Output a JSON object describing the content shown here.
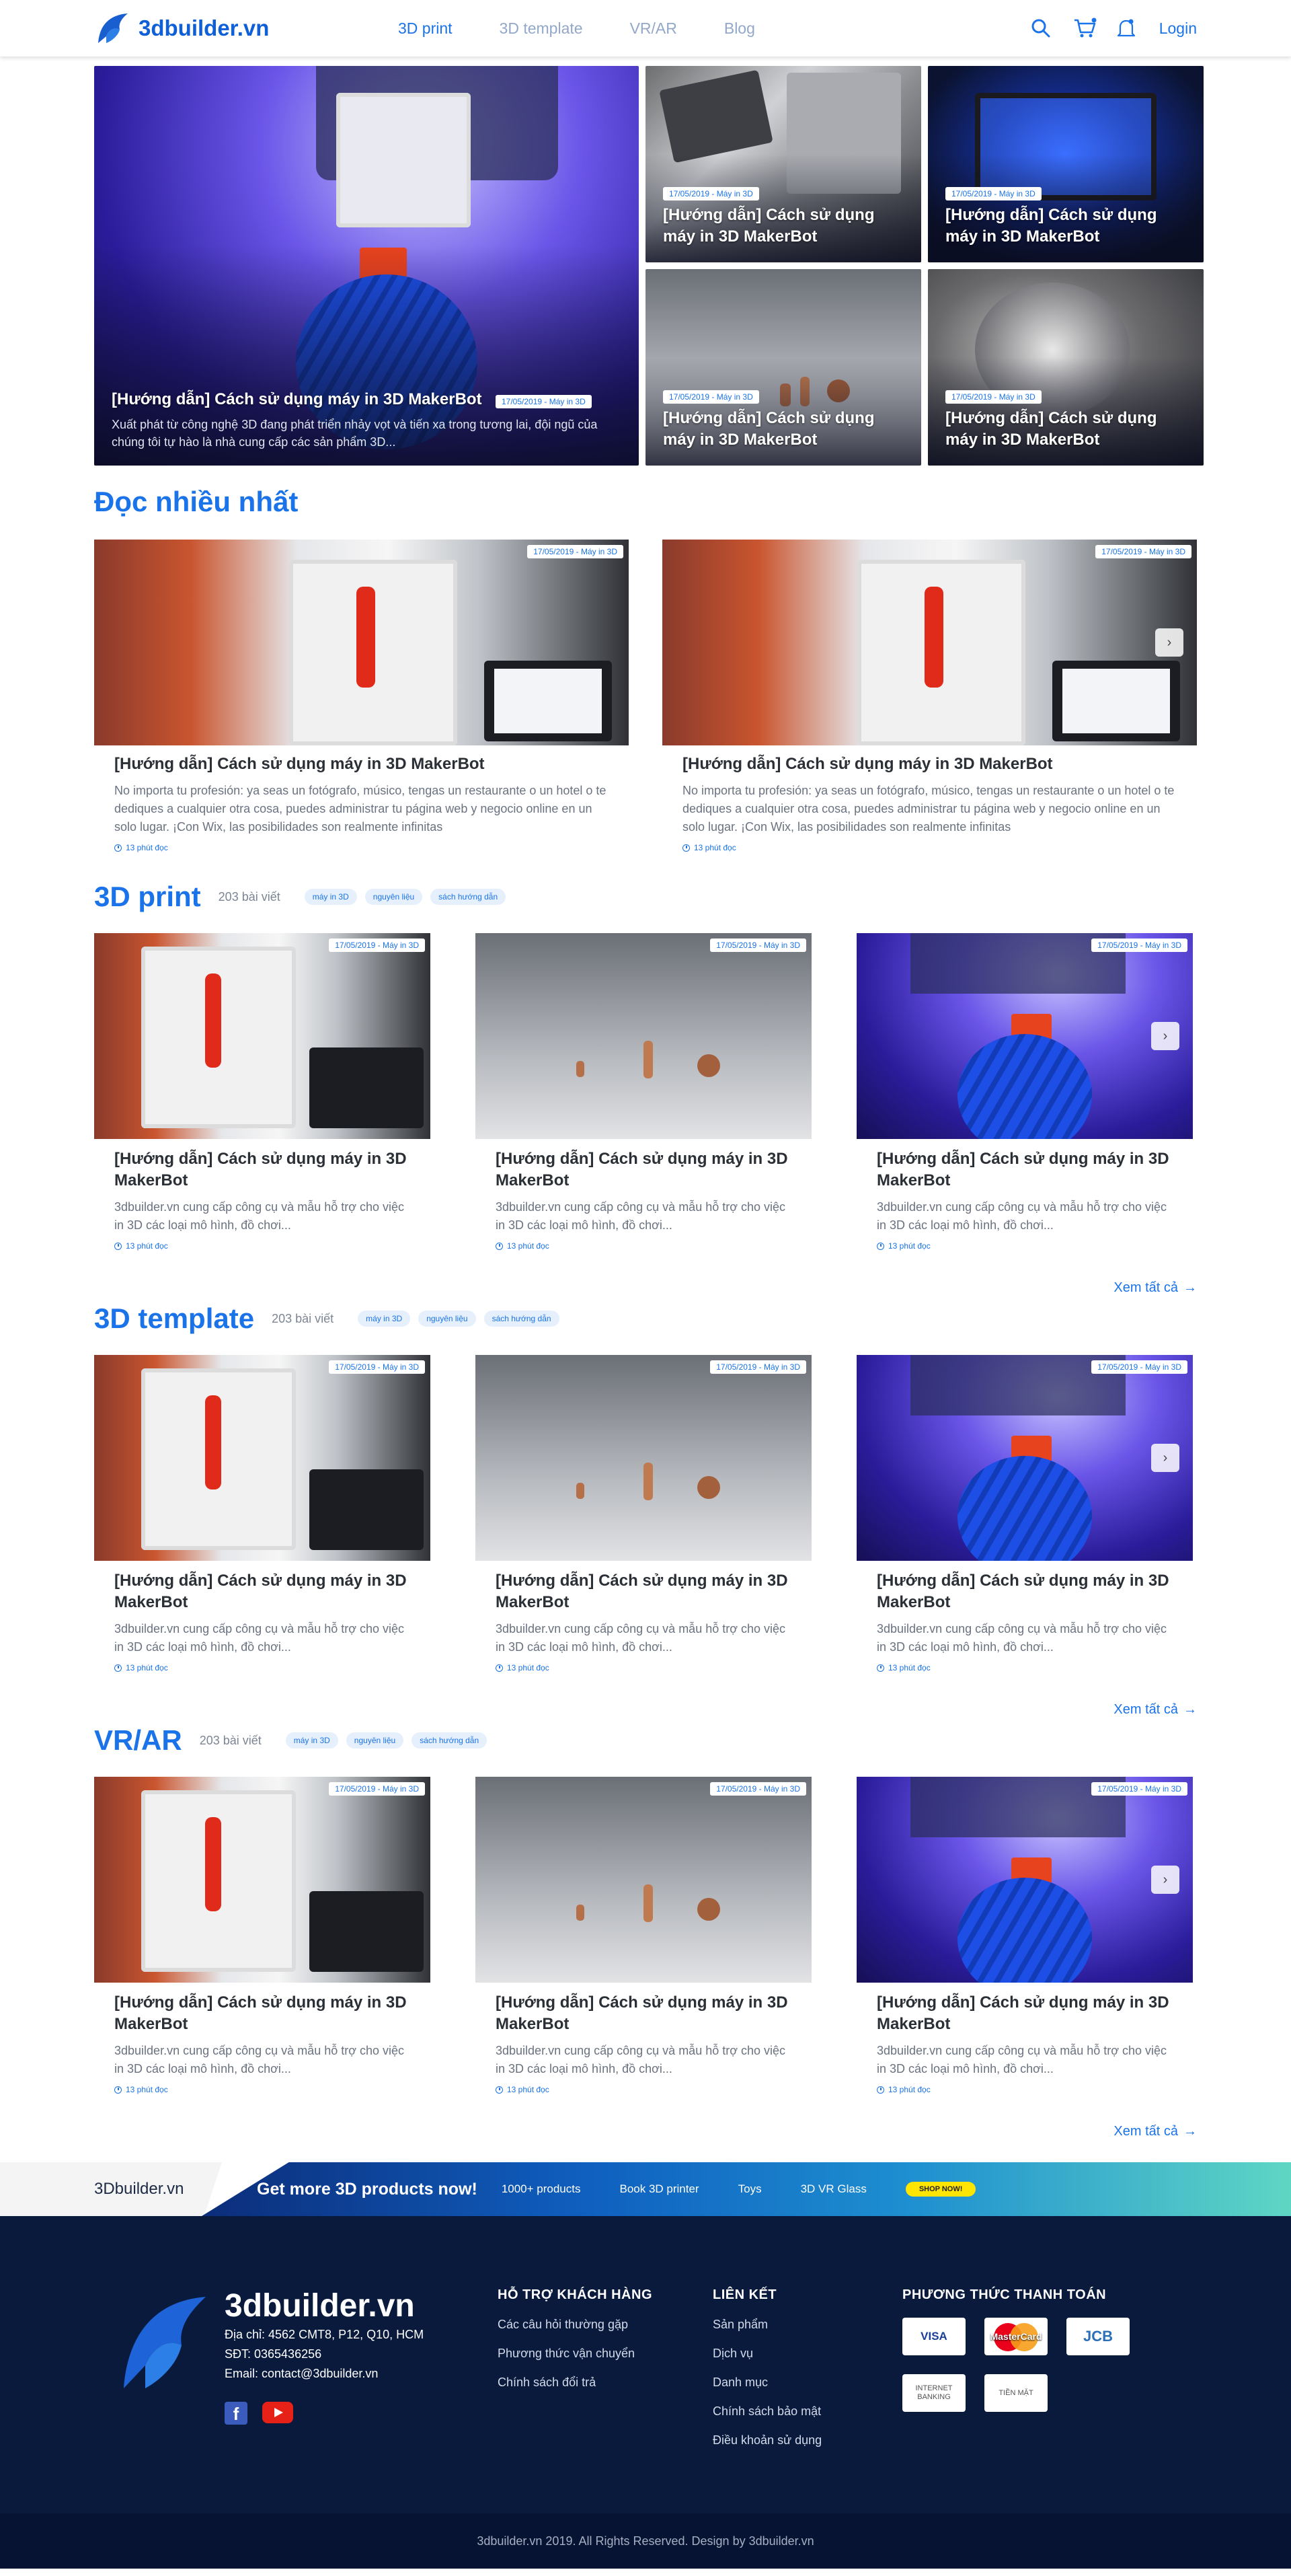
{
  "header": {
    "brand": "3dbuilder.vn",
    "nav": [
      "3D print",
      "3D template",
      "VR/AR",
      "Blog"
    ],
    "nav_active": "3D print",
    "login": "Login",
    "icons": [
      "search-icon",
      "cart-icon",
      "bell-icon"
    ]
  },
  "hero": {
    "main": {
      "title": "[Hướng dẫn] Cách sử dụng máy in 3D MakerBot",
      "badge": "17/05/2019 - Máy in 3D",
      "excerpt": "Xuất phát từ công nghệ 3D đang phát triển nhảy vọt và tiến xa trong tương lai, đội ngũ của chúng tôi tự hào là nhà cung cấp các sản phẩm 3D..."
    },
    "items": [
      {
        "title": "[Hướng dẫn] Cách sử dụng máy in 3D MakerBot",
        "badge": "17/05/2019 - Máy in 3D"
      },
      {
        "title": "[Hướng dẫn] Cách sử dụng máy in 3D MakerBot",
        "badge": "17/05/2019 - Máy in 3D"
      },
      {
        "title": "[Hướng dẫn] Cách sử dụng máy in 3D MakerBot",
        "badge": "17/05/2019 - Máy in 3D"
      },
      {
        "title": "[Hướng dẫn] Cách sử dụng máy in 3D MakerBot",
        "badge": "17/05/2019 - Máy in 3D"
      }
    ]
  },
  "popular": {
    "title": "Đọc nhiều nhất",
    "items": [
      {
        "badge": "17/05/2019 - Máy in 3D",
        "title": "[Hướng dẫn] Cách sử dụng máy in 3D MakerBot",
        "text": "No importa tu profesión: ya seas un fotógrafo, músico, tengas un restaurante o un hotel o te dediques a cualquier otra cosa, puedes administrar tu página web y negocio online en un solo lugar. ¡Con Wix, las posibilidades son realmente infinitas",
        "read": "13 phút đọc"
      },
      {
        "badge": "17/05/2019 - Máy in 3D",
        "title": "[Hướng dẫn] Cách sử dụng máy in 3D MakerBot",
        "text": "No importa tu profesión: ya seas un fotógrafo, músico, tengas un restaurante o un hotel o te dediques a cualquier otra cosa, puedes administrar tu página web y negocio online en un solo lugar. ¡Con Wix, las posibilidades son realmente infinitas",
        "read": "13 phút đọc"
      }
    ]
  },
  "sections": [
    {
      "title": "3D print",
      "count": "203 bài viết",
      "tags": [
        "máy in 3D",
        "nguyên liệu",
        "sách hướng dẫn"
      ],
      "see_all": "Xem tất cả",
      "cards": [
        {
          "badge": "17/05/2019 - Máy in 3D",
          "title": "[Hướng dẫn] Cách sử dụng máy in 3D MakerBot",
          "text": "3dbuilder.vn cung cấp công cụ và mẫu hỗ trợ cho việc in 3D các loại mô hình, đồ chơi...",
          "read": "13 phút đọc"
        },
        {
          "badge": "17/05/2019 - Máy in 3D",
          "title": "[Hướng dẫn] Cách sử dụng máy in 3D MakerBot",
          "text": "3dbuilder.vn cung cấp công cụ và mẫu hỗ trợ cho việc in 3D các loại mô hình, đồ chơi...",
          "read": "13 phút đọc"
        },
        {
          "badge": "17/05/2019 - Máy in 3D",
          "title": "[Hướng dẫn] Cách sử dụng máy in 3D MakerBot",
          "text": "3dbuilder.vn cung cấp công cụ và mẫu hỗ trợ cho việc in 3D các loại mô hình, đồ chơi...",
          "read": "13 phút đọc"
        }
      ]
    },
    {
      "title": "3D template",
      "count": "203 bài viết",
      "tags": [
        "máy in 3D",
        "nguyên liệu",
        "sách hướng dẫn"
      ],
      "see_all": "Xem tất cả",
      "cards": [
        {
          "badge": "17/05/2019 - Máy in 3D",
          "title": "[Hướng dẫn] Cách sử dụng máy in 3D MakerBot",
          "text": "3dbuilder.vn cung cấp công cụ và mẫu hỗ trợ cho việc in 3D các loại mô hình, đồ chơi...",
          "read": "13 phút đọc"
        },
        {
          "badge": "17/05/2019 - Máy in 3D",
          "title": "[Hướng dẫn] Cách sử dụng máy in 3D MakerBot",
          "text": "3dbuilder.vn cung cấp công cụ và mẫu hỗ trợ cho việc in 3D các loại mô hình, đồ chơi...",
          "read": "13 phút đọc"
        },
        {
          "badge": "17/05/2019 - Máy in 3D",
          "title": "[Hướng dẫn] Cách sử dụng máy in 3D MakerBot",
          "text": "3dbuilder.vn cung cấp công cụ và mẫu hỗ trợ cho việc in 3D các loại mô hình, đồ chơi...",
          "read": "13 phút đọc"
        }
      ]
    },
    {
      "title": "VR/AR",
      "count": "203 bài viết",
      "tags": [
        "máy in 3D",
        "nguyên liệu",
        "sách hướng dẫn"
      ],
      "see_all": "Xem tất cả",
      "cards": [
        {
          "badge": "17/05/2019 - Máy in 3D",
          "title": "[Hướng dẫn] Cách sử dụng máy in 3D MakerBot",
          "text": "3dbuilder.vn cung cấp công cụ và mẫu hỗ trợ cho việc in 3D các loại mô hình, đồ chơi...",
          "read": "13 phút đọc"
        },
        {
          "badge": "17/05/2019 - Máy in 3D",
          "title": "[Hướng dẫn] Cách sử dụng máy in 3D MakerBot",
          "text": "3dbuilder.vn cung cấp công cụ và mẫu hỗ trợ cho việc in 3D các loại mô hình, đồ chơi...",
          "read": "13 phút đọc"
        },
        {
          "badge": "17/05/2019 - Máy in 3D",
          "title": "[Hướng dẫn] Cách sử dụng máy in 3D MakerBot",
          "text": "3dbuilder.vn cung cấp công cụ và mẫu hỗ trợ cho việc in 3D các loại mô hình, đồ chơi...",
          "read": "13 phút đọc"
        }
      ]
    }
  ],
  "banner": {
    "brand": "3Dbuilder.vn",
    "title": "Get more 3D products now!",
    "items": [
      "1000+ products",
      "Book 3D printer",
      "Toys",
      "3D VR Glass"
    ],
    "button": "SHOP NOW!"
  },
  "footer": {
    "brand": "3dbuilder.vn",
    "address": "Địa chỉ: 4562 CMT8, P12, Q10, HCM",
    "phone": "SĐT: 0365436256",
    "email": "Email: contact@3dbuilder.vn",
    "support": {
      "title": "HỖ TRỢ KHÁCH HÀNG",
      "items": [
        "Các câu hỏi thường gặp",
        "Phương thức vận chuyển",
        "Chính sách đổi trả"
      ]
    },
    "links": {
      "title": "LIÊN KẾT",
      "items": [
        "Sản phẩm",
        "Dịch vụ",
        "Danh mục",
        "Chính sách bảo mật",
        "Điều khoản sử dụng"
      ]
    },
    "payment": {
      "title": "PHƯƠNG THỨC THANH TOÁN",
      "methods": [
        "VISA",
        "MasterCard",
        "JCB",
        "INTERNET BANKING",
        "TIỀN MẶT"
      ]
    },
    "copyright": "3dbuilder.vn 2019. All Rights Reserved. Design by 3dbuilder.vn"
  },
  "colors": {
    "accent": "#1a73e8",
    "footer_bg": "#0a1a3d",
    "banner_button": "#ffe500"
  }
}
